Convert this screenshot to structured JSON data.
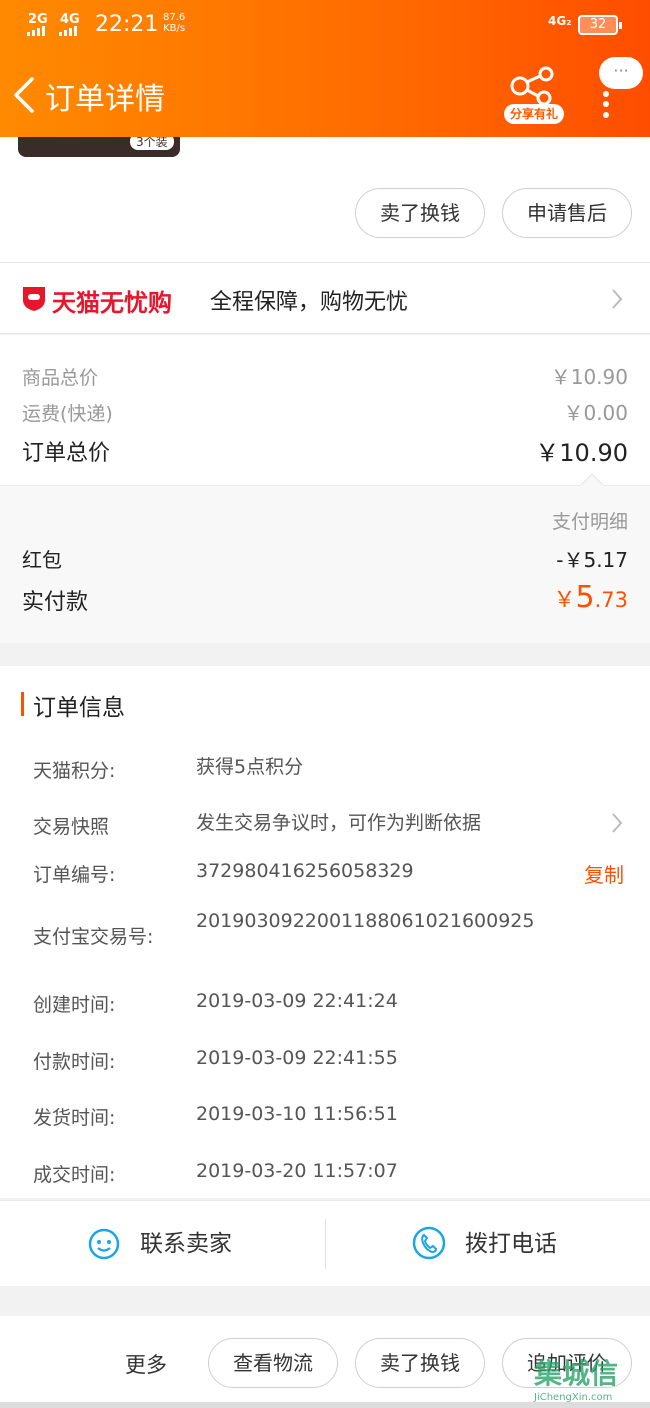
{
  "status_bar": {
    "signal_1": "2G",
    "signal_2": "4G",
    "time": "22:21",
    "speed_value": "87.6",
    "speed_unit": "KB/s",
    "network": "4G₂",
    "battery": "32"
  },
  "header": {
    "title": "订单详情",
    "share_label": "分享有礼",
    "chat_dots": "···"
  },
  "product": {
    "quantity_tag": "3个装"
  },
  "actions_top": {
    "sell_button": "卖了换钱",
    "after_sale_button": "申请售后"
  },
  "tmall_banner": {
    "brand": "天猫无忧购",
    "slogan": "全程保障，购物无忧"
  },
  "price": {
    "goods_total_label": "商品总价",
    "goods_total_value": "￥10.90",
    "shipping_label": "运费(快递)",
    "shipping_value": "￥0.00",
    "order_total_label": "订单总价",
    "order_total_value": "￥10.90"
  },
  "payment": {
    "detail_link": "支付明细",
    "red_packet_label": "红包",
    "red_packet_value": "-￥5.17",
    "paid_label": "实付款",
    "paid_currency": "￥",
    "paid_int": "5",
    "paid_dec": ".73",
    "accent_color": "#ff5000"
  },
  "order_info": {
    "title": "订单信息",
    "points_label": "天猫积分:",
    "points_value": "获得5点积分",
    "snapshot_label": "交易快照",
    "snapshot_value": "发生交易争议时，可作为判断依据",
    "order_no_label": "订单编号:",
    "order_no_value": "372980416256058329",
    "copy_label": "复制",
    "alipay_no_label": "支付宝交易号:",
    "alipay_no_value": "2019030922001188061021600925",
    "created_label": "创建时间:",
    "created_value": "2019-03-09 22:41:24",
    "paid_time_label": "付款时间:",
    "paid_time_value": "2019-03-09 22:41:55",
    "shipped_label": "发货时间:",
    "shipped_value": "2019-03-10 11:56:51",
    "closed_label": "成交时间:",
    "closed_value": "2019-03-20 11:57:07"
  },
  "contact": {
    "seller": "联系卖家",
    "phone": "拨打电话"
  },
  "bottom_actions": {
    "more": "更多",
    "logistics": "查看物流",
    "sell": "卖了换钱",
    "review": "追加评价"
  },
  "watermark": {
    "main": "集城信",
    "sub": "JiChengXin.com"
  }
}
